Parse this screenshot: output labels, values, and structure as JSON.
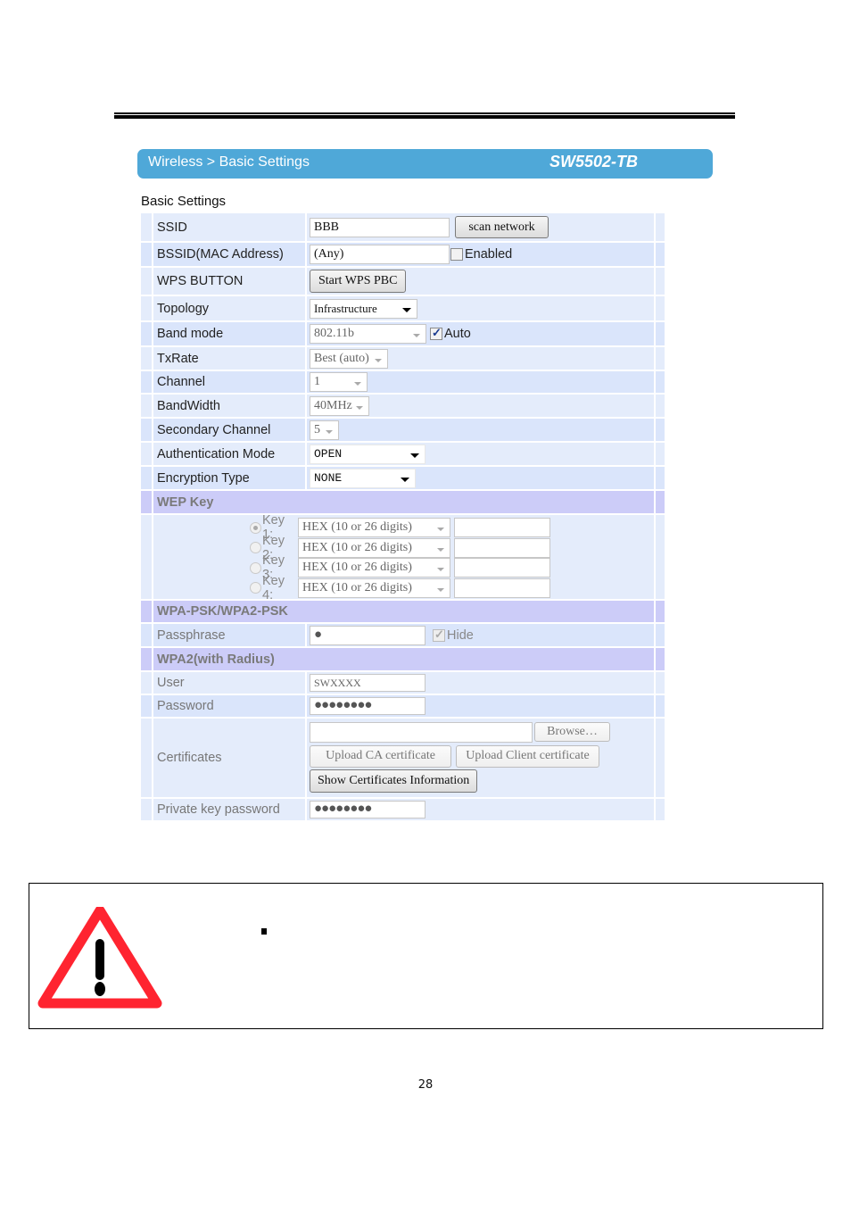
{
  "header": {
    "breadcrumb": "Wireless > Basic Settings",
    "model": "SW5502-TB"
  },
  "section_title": "Basic Settings",
  "basic": {
    "ssid": {
      "label": "SSID",
      "value": "BBB",
      "button": "scan network"
    },
    "bssid": {
      "label": "BSSID(MAC Address)",
      "value": "(Any)",
      "checkbox_label": "Enabled",
      "checked": false
    },
    "wps": {
      "label": "WPS BUTTON",
      "button": "Start WPS PBC"
    },
    "topology": {
      "label": "Topology",
      "value": "Infrastructure"
    },
    "band_mode": {
      "label": "Band mode",
      "value": "802.11b",
      "checkbox_label": "Auto",
      "checked": true
    },
    "txrate": {
      "label": "TxRate",
      "value": "Best (auto)"
    },
    "channel": {
      "label": "Channel",
      "value": "1"
    },
    "bandwidth": {
      "label": "BandWidth",
      "value": "40MHz"
    },
    "secondary_channel": {
      "label": "Secondary Channel",
      "value": "5"
    },
    "auth_mode": {
      "label": "Authentication Mode",
      "value": "OPEN"
    },
    "encryption": {
      "label": "Encryption Type",
      "value": "NONE"
    }
  },
  "wep": {
    "title": "WEP Key",
    "keys": [
      {
        "label": "Key 1:",
        "format": "HEX (10 or 26 digits)",
        "value": "",
        "selected": true
      },
      {
        "label": "Key 2:",
        "format": "HEX (10 or 26 digits)",
        "value": "",
        "selected": false
      },
      {
        "label": "Key 3:",
        "format": "HEX (10 or 26 digits)",
        "value": "",
        "selected": false
      },
      {
        "label": "Key 4:",
        "format": "HEX (10 or 26 digits)",
        "value": "",
        "selected": false
      }
    ]
  },
  "wpa_psk": {
    "title": "WPA-PSK/WPA2-PSK",
    "passphrase_label": "Passphrase",
    "passphrase_mask": "●",
    "hide_label": "Hide",
    "hide_checked": true
  },
  "wpa2_radius": {
    "title": "WPA2(with Radius)",
    "user_label": "User",
    "user_value": "SWXXXX",
    "password_label": "Password",
    "password_mask": "●●●●●●●●",
    "certificates_label": "Certificates",
    "file_value": "",
    "browse_button": "Browse…",
    "upload_ca_button": "Upload CA certificate",
    "upload_client_button": "Upload Client certificate",
    "show_info_button": "Show Certificates Information",
    "private_key_label": "Private key password",
    "private_key_mask": "●●●●●●●●"
  },
  "warning": {
    "icon": "warning-triangle-icon",
    "bullet": "■",
    "text": ""
  },
  "page_number": "28",
  "colors": {
    "title_bar": "#4fa8d8",
    "row_light": "#e4ecfb",
    "row_dark": "#dae5fb",
    "section_head": "#ccccf8",
    "warning_red": "#ff2430"
  }
}
